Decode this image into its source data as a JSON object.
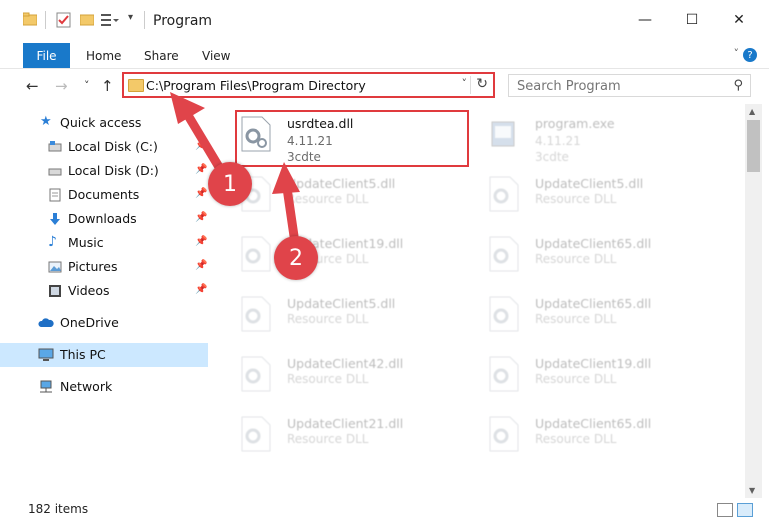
{
  "window": {
    "title": "Program",
    "min_glyph": "—",
    "max_glyph": "☐",
    "close_glyph": "✕"
  },
  "ribbon": {
    "tabs": [
      "File",
      "Home",
      "Share",
      "View"
    ],
    "help": "?"
  },
  "nav": {
    "back": "←",
    "forward": "→",
    "recent": "˅",
    "up": "↑",
    "address": "C:\\Program Files\\Program Directory",
    "dropdown": "˅",
    "refresh": "↻",
    "search_placeholder": "Search Program",
    "search_icon": "search-icon"
  },
  "sidebar": {
    "items": [
      {
        "label": "Quick access",
        "icon": "star-icon",
        "pinned": false
      },
      {
        "label": "Local Disk (C:)",
        "icon": "drive-icon",
        "pinned": true
      },
      {
        "label": "Local Disk (D:)",
        "icon": "drive-icon",
        "pinned": true
      },
      {
        "label": "Documents",
        "icon": "documents-icon",
        "pinned": true
      },
      {
        "label": "Downloads",
        "icon": "download-icon",
        "pinned": true
      },
      {
        "label": "Music",
        "icon": "music-icon",
        "pinned": true
      },
      {
        "label": "Pictures",
        "icon": "pictures-icon",
        "pinned": true
      },
      {
        "label": "Videos",
        "icon": "videos-icon",
        "pinned": true
      },
      {
        "label": "OneDrive",
        "icon": "cloud-icon",
        "pinned": false
      },
      {
        "label": "This PC",
        "icon": "computer-icon",
        "pinned": false
      },
      {
        "label": "Network",
        "icon": "network-icon",
        "pinned": false
      }
    ]
  },
  "files": [
    {
      "name": "usrdtea.dll",
      "line2": "4.11.21",
      "line3": "3cdte",
      "type": "dll"
    },
    {
      "name": "program.exe",
      "line2": "4.11.21",
      "line3": "3cdte",
      "type": "exe"
    },
    {
      "name": "UpdateClient5.dll",
      "line2": "Resource DLL",
      "type": "dll"
    },
    {
      "name": "UpdateClient5.dll",
      "line2": "Resource DLL",
      "type": "dll"
    },
    {
      "name": "UpdateClient19.dll",
      "line2": "Resource DLL",
      "type": "dll"
    },
    {
      "name": "UpdateClient65.dll",
      "line2": "Resource DLL",
      "type": "dll"
    },
    {
      "name": "UpdateClient5.dll",
      "line2": "Resource DLL",
      "type": "dll"
    },
    {
      "name": "UpdateClient65.dll",
      "line2": "Resource DLL",
      "type": "dll"
    },
    {
      "name": "UpdateClient42.dll",
      "line2": "Resource DLL",
      "type": "dll"
    },
    {
      "name": "UpdateClient19.dll",
      "line2": "Resource DLL",
      "type": "dll"
    },
    {
      "name": "UpdateClient21.dll",
      "line2": "Resource DLL",
      "type": "dll"
    },
    {
      "name": "UpdateClient65.dll",
      "line2": "Resource DLL",
      "type": "dll"
    }
  ],
  "status": {
    "count": "182 items"
  },
  "annotations": {
    "step1": "1",
    "step2": "2",
    "color": "#e0444a"
  },
  "colors": {
    "accent": "#1979ca",
    "highlight_border": "#e03a3e",
    "selected_bg": "#cce8ff"
  }
}
